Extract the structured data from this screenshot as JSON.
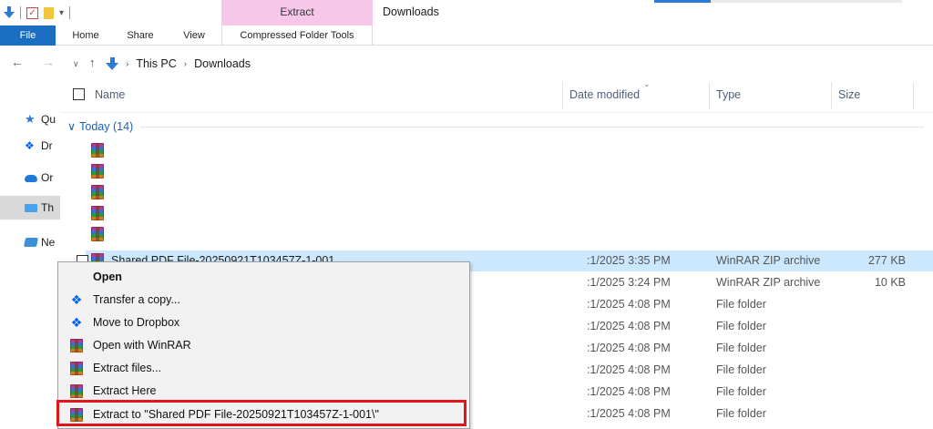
{
  "titlebar": {
    "context_tab": "Extract",
    "window_title": "Downloads"
  },
  "ribbon": {
    "tabs": [
      "File",
      "Home",
      "Share",
      "View",
      "Compressed Folder Tools"
    ]
  },
  "address": {
    "crumbs": [
      "This PC",
      "Downloads"
    ]
  },
  "navpane": {
    "items": [
      {
        "label": "Qu",
        "icon": "star-icon"
      },
      {
        "label": "Dr",
        "icon": "dropbox-icon"
      },
      {
        "label": "Or",
        "icon": "onedrive-icon"
      },
      {
        "label": "Th",
        "icon": "pc-icon"
      },
      {
        "label": "Ne",
        "icon": "network-icon"
      }
    ]
  },
  "columns": {
    "name": "Name",
    "date": "Date modified",
    "type": "Type",
    "size": "Size"
  },
  "group": {
    "label": "Today (14)"
  },
  "files": [
    {
      "name": "",
      "date": "",
      "type": "",
      "size": ""
    },
    {
      "name": "",
      "date": "",
      "type": "",
      "size": ""
    },
    {
      "name": "",
      "date": "",
      "type": "",
      "size": ""
    },
    {
      "name": "",
      "date": "",
      "type": "",
      "size": ""
    },
    {
      "name": "",
      "date": "",
      "type": "",
      "size": ""
    },
    {
      "name": "Shared PDF File-20250921T103457Z-1-001",
      "date": ":1/2025 3:35 PM",
      "type": "WinRAR ZIP archive",
      "size": "277 KB"
    },
    {
      "name": "",
      "date": ":1/2025 3:24 PM",
      "type": "WinRAR ZIP archive",
      "size": "10 KB"
    },
    {
      "name": "",
      "date": ":1/2025 4:08 PM",
      "type": "File folder",
      "size": ""
    },
    {
      "name": "",
      "date": ":1/2025 4:08 PM",
      "type": "File folder",
      "size": ""
    },
    {
      "name": "",
      "date": ":1/2025 4:08 PM",
      "type": "File folder",
      "size": ""
    },
    {
      "name": "",
      "date": ":1/2025 4:08 PM",
      "type": "File folder",
      "size": ""
    },
    {
      "name": "",
      "date": ":1/2025 4:08 PM",
      "type": "File folder",
      "size": ""
    },
    {
      "name": "",
      "date": ":1/2025 4:08 PM",
      "type": "File folder",
      "size": ""
    }
  ],
  "context_menu": {
    "items": [
      {
        "label": "Open",
        "icon": "none",
        "bold": true
      },
      {
        "label": "Transfer a copy...",
        "icon": "dropbox-icon"
      },
      {
        "label": "Move to Dropbox",
        "icon": "dropbox-icon"
      },
      {
        "label": "Open with WinRAR",
        "icon": "winrar-icon"
      },
      {
        "label": "Extract files...",
        "icon": "winrar-icon"
      },
      {
        "label": "Extract Here",
        "icon": "winrar-icon"
      },
      {
        "label": "Extract to \"Shared PDF File-20250921T103457Z-1-001\\\"",
        "icon": "winrar-icon"
      }
    ]
  },
  "colors": {
    "selection": "#cce8ff",
    "accent": "#1a6ec1",
    "highlight_box": "#e0151d",
    "context_tab_bg": "#f7c7ea"
  }
}
